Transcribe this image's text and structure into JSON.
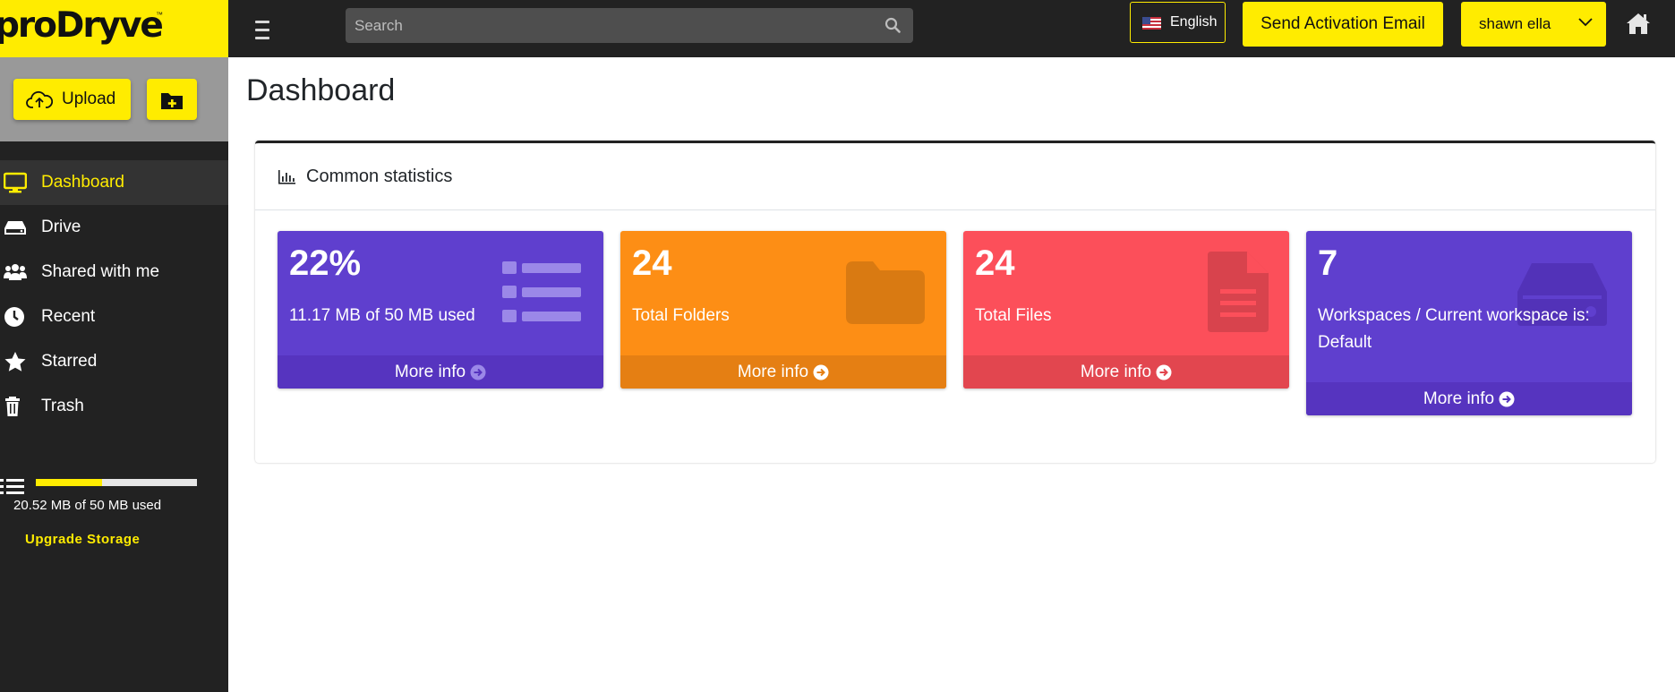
{
  "app": {
    "logo_text": "proDryve",
    "logo_tm": "™"
  },
  "topbar": {
    "search_placeholder": "Search",
    "language_label": "English",
    "activation_label": "Send Activation Email",
    "user_label": "shawn ella"
  },
  "sidebar": {
    "upload_label": "Upload",
    "nav": [
      {
        "label": "Dashboard",
        "icon": "monitor-icon",
        "active": true
      },
      {
        "label": "Drive",
        "icon": "hard-drive-icon",
        "active": false
      },
      {
        "label": "Shared with me",
        "icon": "users-icon",
        "active": false
      },
      {
        "label": "Recent",
        "icon": "clock-icon",
        "active": false
      },
      {
        "label": "Starred",
        "icon": "star-icon",
        "active": false
      },
      {
        "label": "Trash",
        "icon": "trash-icon",
        "active": false
      }
    ],
    "storage": {
      "used_fraction": 0.41,
      "text": "20.52 MB of 50 MB used",
      "upgrade_label": "Upgrade Storage"
    }
  },
  "main": {
    "page_title": "Dashboard",
    "stats_title": "Common statistics",
    "boxes": [
      {
        "value": "22%",
        "description": "11.17 MB of 50 MB used",
        "more_label": "More info",
        "icon": "list-icon",
        "color": "#5f3fce"
      },
      {
        "value": "24",
        "description": "Total Folders",
        "more_label": "More info",
        "icon": "folder-icon",
        "color": "#fd8e15"
      },
      {
        "value": "24",
        "description": "Total Files",
        "more_label": "More info",
        "icon": "file-text-icon",
        "color": "#fc4f5a"
      },
      {
        "value": "7",
        "description": "Workspaces / Current workspace is: Default",
        "more_label": "More info",
        "icon": "hard-drive-icon",
        "color": "#5f3fce"
      }
    ]
  },
  "colors": {
    "brand_yellow": "#ffec00",
    "dark": "#222222",
    "purple": "#5f3fce",
    "orange": "#fd8e15",
    "red": "#fc4f5a"
  }
}
